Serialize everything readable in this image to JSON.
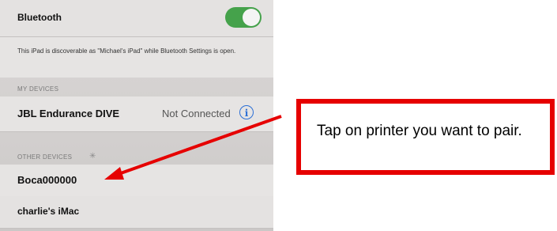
{
  "bluetooth": {
    "title": "Bluetooth",
    "enabled": true,
    "description": "This iPad is discoverable as \"Michael's iPad\" while Bluetooth Settings is open."
  },
  "my_devices": {
    "header": "MY DEVICES",
    "items": [
      {
        "name": "JBL Endurance DIVE",
        "status": "Not Connected",
        "icon": "info-icon"
      }
    ]
  },
  "other_devices": {
    "header": "OTHER DEVICES",
    "icon": "spinner-icon",
    "items": [
      {
        "name": "Boca000000"
      },
      {
        "name": "charlie's iMac"
      }
    ]
  },
  "callout": {
    "text": "Tap on printer you want to pair.",
    "border_color": "#e60000"
  },
  "colors": {
    "toggle_on": "#45a24b",
    "info_blue": "#2c6fd6",
    "arrow": "#e60000"
  }
}
